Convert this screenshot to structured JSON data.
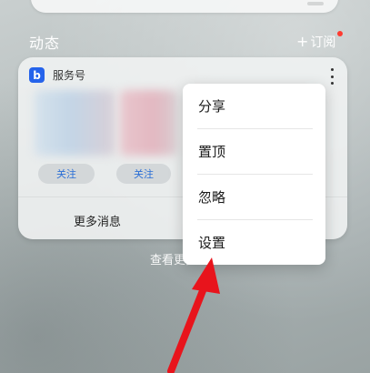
{
  "section": {
    "title": "动态",
    "subscribe_label": "订阅",
    "subscribe_icon": "plus-icon",
    "notification_color": "#ff3b30"
  },
  "card": {
    "app_icon_letter": "b",
    "app_icon_color": "#2563eb",
    "title": "服务号",
    "follow_buttons": [
      "关注",
      "关注"
    ],
    "more_messages_label": "更多消息"
  },
  "view_more_label": "查看更多",
  "menu": {
    "items": [
      "分享",
      "置顶",
      "忽略",
      "设置"
    ]
  },
  "annotation": {
    "arrow_color": "#e8141c"
  }
}
